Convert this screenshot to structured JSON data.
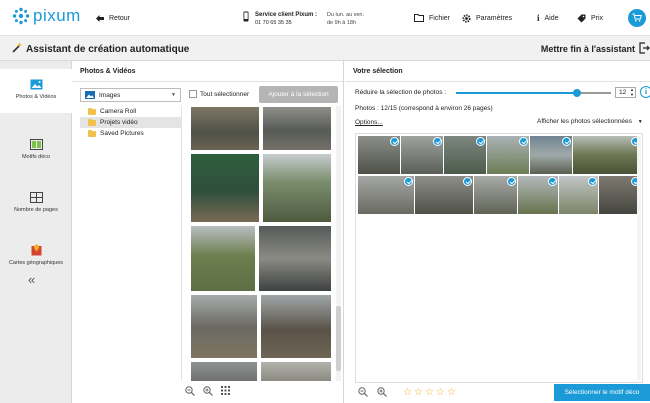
{
  "brand": {
    "name": "pixum",
    "accent": "#1a9ad6"
  },
  "topbar": {
    "back_label": "Retour",
    "service_title": "Service client Pixum :",
    "service_phone": "01 70 65 35 35",
    "hours_line1": "Du lun. au ven.",
    "hours_line2": "de 9h à 18h",
    "file_label": "Fichier",
    "settings_label": "Paramètres",
    "help_label": "Aide",
    "price_label": "Prix"
  },
  "titlebar": {
    "title": "Assistant de création automatique",
    "finish_label": "Mettre fin à l'assistant"
  },
  "rail": {
    "items": [
      {
        "label": "Photos & Vidéos",
        "icon": "photo-icon"
      },
      {
        "label": "Motifs déco",
        "icon": "motif-icon"
      },
      {
        "label": "Nombre de pages",
        "icon": "pages-icon"
      },
      {
        "label": "Cartes géographiques",
        "icon": "map-icon"
      }
    ],
    "collapse_label": "«"
  },
  "photos_panel": {
    "title": "Photos & Vidéos",
    "source_value": "Images",
    "select_all_label": "Tout sélectionner",
    "add_button_label": "Ajouter à la sélection",
    "folders": [
      "Camera Roll",
      "Projets vidéo",
      "Saved Pictures"
    ],
    "selected_folder_index": 1
  },
  "selection_panel": {
    "title": "Votre sélection",
    "reduce_label": "Réduire la sélection de photos :",
    "reduce_value": "12",
    "reduce_fraction": 0.78,
    "count_text": "Photos : 12/15  (correspond à environ 26 pages)",
    "options_label": "Options...",
    "show_select_value": "Afficher les photos sélectionnées",
    "rating_stars": 5,
    "motif_button_label": "Sélectionner le motif déco"
  }
}
